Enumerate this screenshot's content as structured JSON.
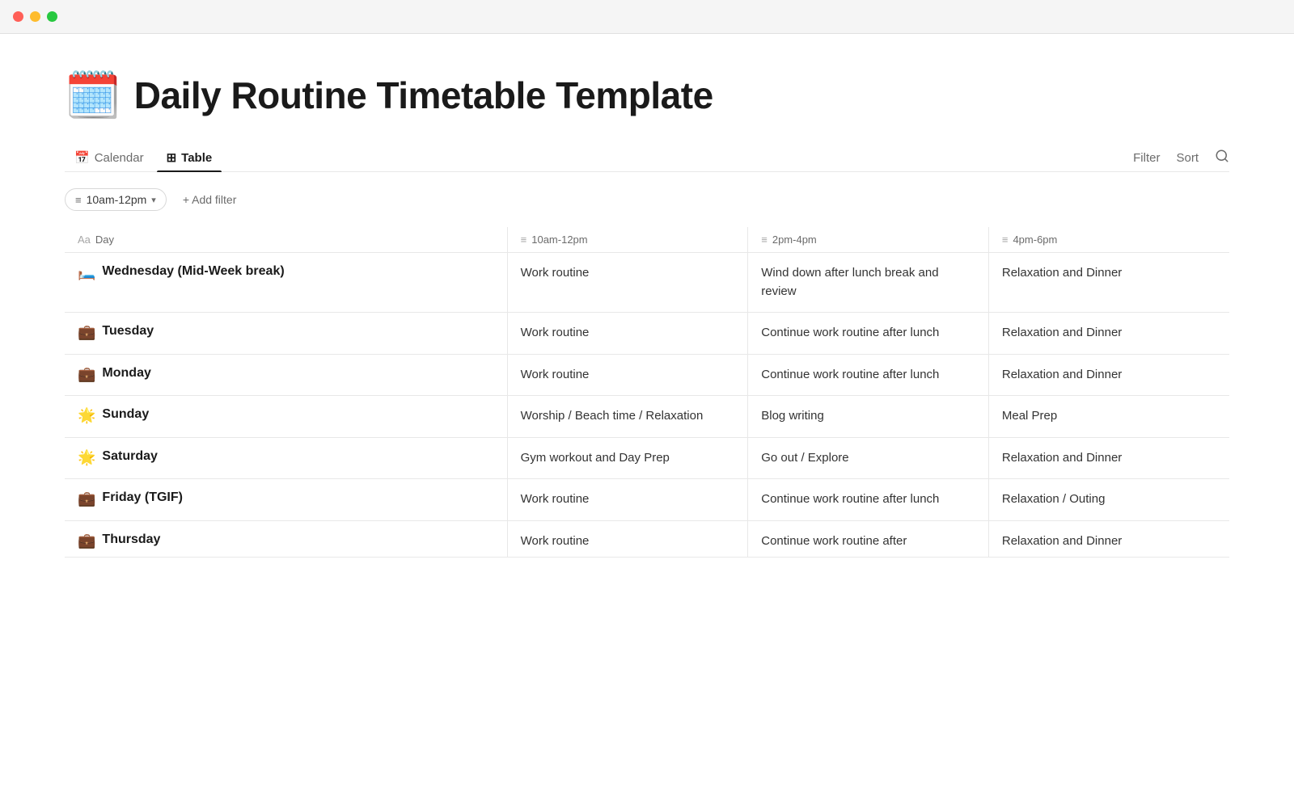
{
  "window": {
    "traffic_lights": [
      "red",
      "yellow",
      "green"
    ]
  },
  "page": {
    "emoji": "🗓️",
    "title": "Daily Routine Timetable Template"
  },
  "tabs": {
    "items": [
      {
        "id": "calendar",
        "label": "Calendar",
        "icon": "📅",
        "active": false
      },
      {
        "id": "table",
        "label": "Table",
        "icon": "⊞",
        "active": true
      }
    ],
    "right_actions": [
      {
        "id": "filter",
        "label": "Filter"
      },
      {
        "id": "sort",
        "label": "Sort"
      },
      {
        "id": "search",
        "label": "🔍"
      }
    ]
  },
  "filter_bar": {
    "active_filter": "10am-12pm",
    "add_filter_label": "+ Add filter"
  },
  "table": {
    "columns": [
      {
        "id": "day",
        "icon": "Aa",
        "label": "Day"
      },
      {
        "id": "col1",
        "icon": "≡",
        "label": "10am-12pm"
      },
      {
        "id": "col2",
        "icon": "≡",
        "label": "2pm-4pm"
      },
      {
        "id": "col3",
        "icon": "≡",
        "label": "4pm-6pm"
      }
    ],
    "rows": [
      {
        "id": "wednesday",
        "day_emoji": "🛏️",
        "day": "Wednesday (Mid-Week break)",
        "col1": "Work routine",
        "col2": "Wind down after lunch break and review",
        "col3": "Relaxation and Dinner"
      },
      {
        "id": "tuesday",
        "day_emoji": "💼",
        "day": "Tuesday",
        "col1": "Work routine",
        "col2": "Continue work routine after lunch",
        "col3": "Relaxation and Dinner"
      },
      {
        "id": "monday",
        "day_emoji": "💼",
        "day": "Monday",
        "col1": "Work routine",
        "col2": "Continue work routine after lunch",
        "col3": "Relaxation and Dinner"
      },
      {
        "id": "sunday",
        "day_emoji": "🌟",
        "day": "Sunday",
        "col1": "Worship / Beach time / Relaxation",
        "col2": "Blog writing",
        "col3": "Meal Prep"
      },
      {
        "id": "saturday",
        "day_emoji": "🌟",
        "day": "Saturday",
        "col1": "Gym workout and Day Prep",
        "col2": "Go out / Explore",
        "col3": "Relaxation and Dinner"
      },
      {
        "id": "friday",
        "day_emoji": "💼",
        "day": "Friday (TGIF)",
        "col1": "Work routine",
        "col2": "Continue work routine after lunch",
        "col3": "Relaxation / Outing"
      },
      {
        "id": "thursday",
        "day_emoji": "💼",
        "day": "Thursday",
        "col1": "Work routine",
        "col2": "Continue work routine after",
        "col3": "Relaxation and Dinner"
      }
    ]
  }
}
